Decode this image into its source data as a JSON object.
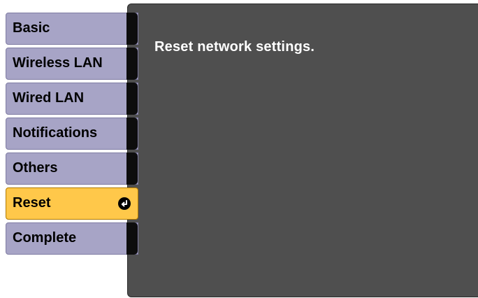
{
  "menu": {
    "items": [
      {
        "label": "Basic"
      },
      {
        "label": "Wireless LAN"
      },
      {
        "label": "Wired LAN"
      },
      {
        "label": "Notifications"
      },
      {
        "label": "Others"
      },
      {
        "label": "Reset",
        "selected": true,
        "icon": "enter-icon"
      },
      {
        "label": "Complete"
      }
    ]
  },
  "panel": {
    "text": "Reset network settings."
  },
  "colors": {
    "menu_item_bg": "#a7a4c6",
    "selected_bg": "#ffc84a",
    "panel_bg": "#4f4f4f",
    "panel_text": "#ffffff"
  }
}
